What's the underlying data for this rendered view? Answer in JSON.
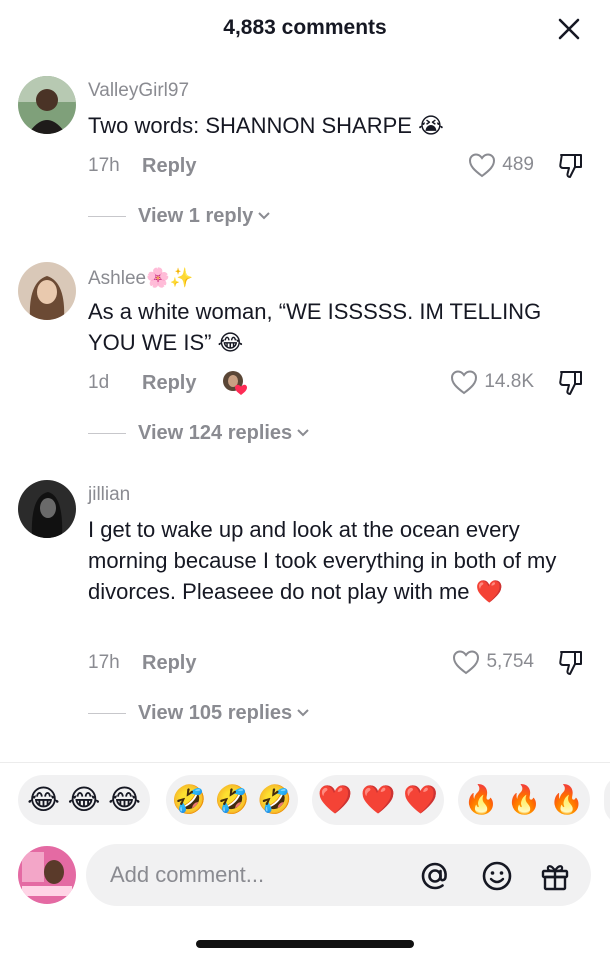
{
  "header": {
    "title": "4,883 comments"
  },
  "comments": [
    {
      "username": "ValleyGirl97",
      "username_emoji": "",
      "text": "Two words: SHANNON SHARPE 😭",
      "time": "17h",
      "reply_label": "Reply",
      "likes": "489",
      "view_replies": "View 1 reply"
    },
    {
      "username": "Ashlee",
      "username_emoji": "🌸✨",
      "text": "As a white woman, “WE ISSSSS. IM TELLING YOU WE IS” 😂",
      "time": "1d",
      "reply_label": "Reply",
      "likes": "14.8K",
      "view_replies": "View 124 replies"
    },
    {
      "username": "jillian",
      "username_emoji": "",
      "text": "I get to wake up and look at the ocean every morning because I took everything in both of my divorces. Pleaseee do not play with me ❤️",
      "time": "17h",
      "reply_label": "Reply",
      "likes": "5,754",
      "view_replies": "View 105 replies"
    }
  ],
  "emoji_bar": [
    {
      "emojis": "😂 😂 😂"
    },
    {
      "emojis": "🤣 🤣 🤣"
    },
    {
      "emojis": "❤️ ❤️ ❤️"
    },
    {
      "emojis": "🔥 🔥 🔥"
    }
  ],
  "input": {
    "placeholder": "Add comment...",
    "value": ""
  },
  "icons": {
    "close": "close-icon",
    "like": "heart-outline-icon",
    "dislike": "thumbs-down-icon",
    "mention": "at-sign-icon",
    "emoji": "smiley-icon",
    "gift": "gift-icon"
  },
  "colors": {
    "text": "#161823",
    "muted": "#8a8b91",
    "pill": "#f1f1f2"
  }
}
